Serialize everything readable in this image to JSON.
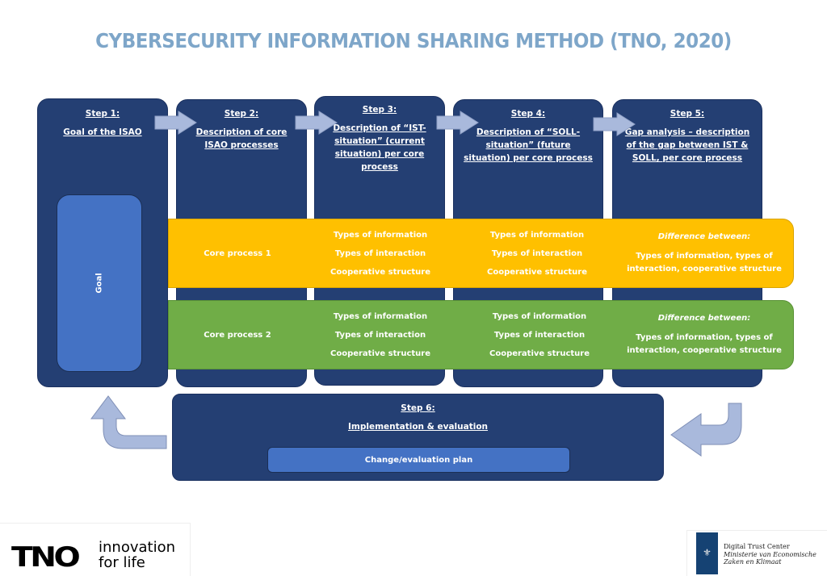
{
  "title": "CYBERSECURITY INFORMATION SHARING METHOD (TNO, 2020)",
  "colors": {
    "title": "#7ea6c9",
    "step_bg": "#243f73",
    "inner_box": "#4472c4",
    "arrow": "#a9b9dc",
    "core1": "#ffc000",
    "core2": "#70ad47"
  },
  "steps": [
    {
      "label": "Step 1:",
      "description": "Goal of the ISAO"
    },
    {
      "label": "Step 2:",
      "description": "Description of core ISAO processes"
    },
    {
      "label": "Step 3:",
      "description": "Description of “IST-situation” (current situation) per core process"
    },
    {
      "label": "Step 4:",
      "description": "Description of “SOLL-situation” (future situation) per core process"
    },
    {
      "label": "Step 5:",
      "description": "Gap analysis – description of the gap between IST & SOLL, per core process"
    }
  ],
  "goal_label": "Goal",
  "core_processes": [
    {
      "name": "Core process 1",
      "ist": [
        "Types of information",
        "Types of interaction",
        "Cooperative structure"
      ],
      "soll": [
        "Types of information",
        "Types of interaction",
        "Cooperative structure"
      ],
      "gap_heading": "Difference between:",
      "gap_text": "Types of information, types of interaction, cooperative structure"
    },
    {
      "name": "Core process 2",
      "ist": [
        "Types of information",
        "Types of interaction",
        "Cooperative structure"
      ],
      "soll": [
        "Types of information",
        "Types of interaction",
        "Cooperative structure"
      ],
      "gap_heading": "Difference between:",
      "gap_text": "Types of information, types of interaction, cooperative structure"
    }
  ],
  "step6": {
    "label": "Step 6:",
    "description": "Implementation & evaluation",
    "plan": "Change/evaluation plan"
  },
  "logos": {
    "tno_mark": "TNO",
    "tno_tagline_1": "innovation",
    "tno_tagline_2": "for life",
    "dtc_name": "Digital Trust Center",
    "dtc_ministry": "Ministerie van Economische Zaken en Klimaat",
    "dtc_crest_icon": "⚜"
  }
}
